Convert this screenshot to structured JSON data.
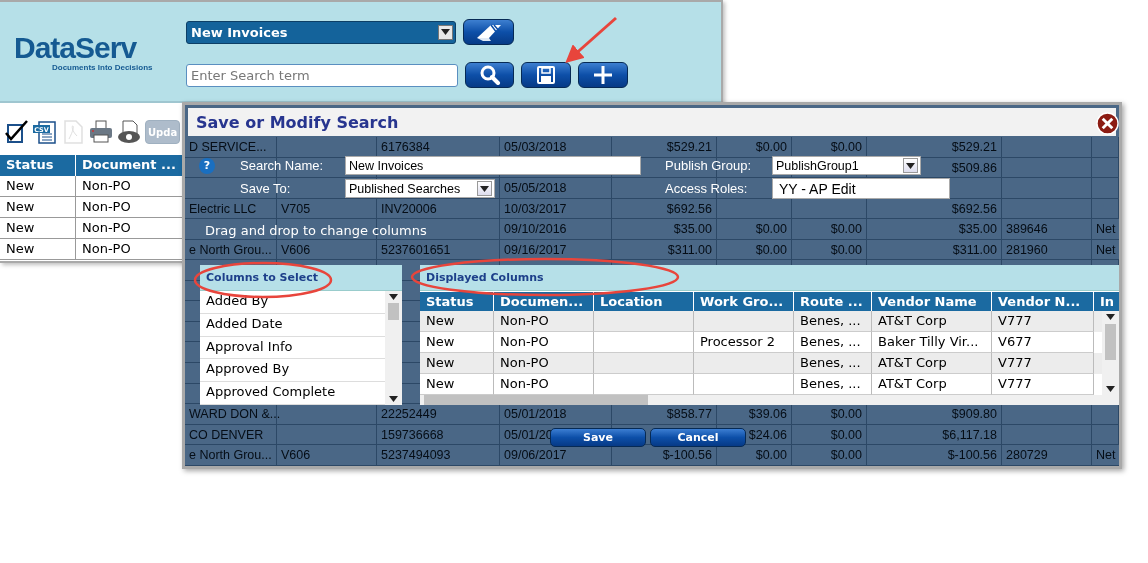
{
  "app": {
    "logo": {
      "name": "DataServ",
      "tagline": "Documents Into Decisions"
    },
    "saved_search_select": {
      "value": "New Invoices"
    },
    "search_field": {
      "placeholder": "Enter Search term"
    },
    "toolbar": [
      {
        "kind": "select-all",
        "disabled": false
      },
      {
        "kind": "csv",
        "label": "CSV",
        "disabled": false
      },
      {
        "kind": "pdf",
        "disabled": true
      },
      {
        "kind": "print",
        "disabled": false
      },
      {
        "kind": "preview",
        "disabled": false
      },
      {
        "kind": "button",
        "label": "Upda",
        "disabled": true
      }
    ],
    "table": {
      "columns": [
        "Status",
        "Document ..."
      ],
      "rows": [
        [
          "New",
          "Non-PO"
        ],
        [
          "New",
          "Non-PO"
        ],
        [
          "New",
          "Non-PO"
        ],
        [
          "New",
          "Non-PO"
        ]
      ]
    }
  },
  "background_rows": [
    {
      "col_1": "D SERVICE...",
      "col_3": "6176384",
      "col_4": "05/03/2018",
      "col_5": "$529.21",
      "col_6": "$0.00",
      "col_7": "$0.00",
      "col_8": "$529.21"
    },
    {
      "col_8": "$509.86"
    },
    {
      "col_4": "05/05/2018"
    },
    {
      "col_1": "Electric LLC",
      "col_2": "V705",
      "col_3": "INV20006",
      "col_4": "10/03/2017",
      "col_5": "$692.56",
      "col_8": "$692.56"
    },
    {
      "col_4": "09/10/2016",
      "col_5": "$35.00",
      "col_6": "$0.00",
      "col_7": "$0.00",
      "col_8": "$35.00",
      "col_9": "389646",
      "col_10": "Net"
    },
    {
      "col_1": "e North Grou...",
      "col_2": "V606",
      "col_3": "5237601651",
      "col_4": "09/16/2017",
      "col_5": "$311.00",
      "col_6": "$0.00",
      "col_7": "$0.00",
      "col_8": "$311.00",
      "col_9": "281960",
      "col_10": "Net"
    },
    {},
    {},
    {},
    {},
    {},
    {},
    {},
    {
      "col_1": "WARD DON &...",
      "col_3": "22252449",
      "col_4": "05/01/2018",
      "col_5": "$858.77",
      "col_6": "$39.06",
      "col_7": "$0.00",
      "col_8": "$909.80"
    },
    {
      "col_1": "CO DENVER",
      "col_3": "159736668",
      "col_4": "05/01/20",
      "col_6": "$24.06",
      "col_7": "$0.00",
      "col_8": "$6,117.18"
    },
    {
      "col_1": "e North Grou...",
      "col_2": "V606",
      "col_3": "5237494093",
      "col_4": "09/06/2017",
      "col_5": "$-100.56",
      "col_6": "$0.00",
      "col_7": "$0.00",
      "col_8": "$-100.56",
      "col_9": "280729",
      "col_10": "Net"
    }
  ],
  "dialog": {
    "title": "Save or Modify Search",
    "help": "?",
    "fields": [
      {
        "label": "Search Name:",
        "kind": "input",
        "value": "New Invoices"
      },
      {
        "label": "Publish Group:",
        "kind": "select",
        "value": "PublishGroup1"
      },
      {
        "label": "Save To:",
        "kind": "select",
        "value": "Published Searches"
      },
      {
        "label": "Access Roles:",
        "kind": "box",
        "value": "YY - AP Edit"
      }
    ],
    "instruction": "Drag and drop to change columns",
    "columns_to_select": {
      "title": "Columns to Select",
      "items": [
        "Added By",
        "Added Date",
        "Approval Info",
        "Approved By",
        "Approved Complete"
      ]
    },
    "displayed_columns": {
      "title": "Displayed Columns",
      "columns": [
        "Status",
        "Documen...",
        "Location",
        "Work Gro...",
        "Route ...",
        "Vendor Name",
        "Vendor N...",
        "In"
      ],
      "rows": [
        {
          "col_1": "New",
          "col_2": "Non-PO",
          "col_5": "Benes, ...",
          "col_6": "AT&T Corp",
          "col_7": "V777"
        },
        {
          "col_1": "New",
          "col_2": "Non-PO",
          "col_4": "Processor 2",
          "col_5": "Benes, ...",
          "col_6": "Baker Tilly Vir...",
          "col_7": "V677"
        },
        {
          "col_1": "New",
          "col_2": "Non-PO",
          "col_5": "Benes, ...",
          "col_6": "AT&T Corp",
          "col_7": "V777"
        },
        {
          "col_1": "New",
          "col_2": "Non-PO",
          "col_5": "Benes, ...",
          "col_6": "AT&T Corp",
          "col_7": "V777"
        }
      ]
    },
    "buttons": [
      "Save",
      "Cancel"
    ]
  }
}
